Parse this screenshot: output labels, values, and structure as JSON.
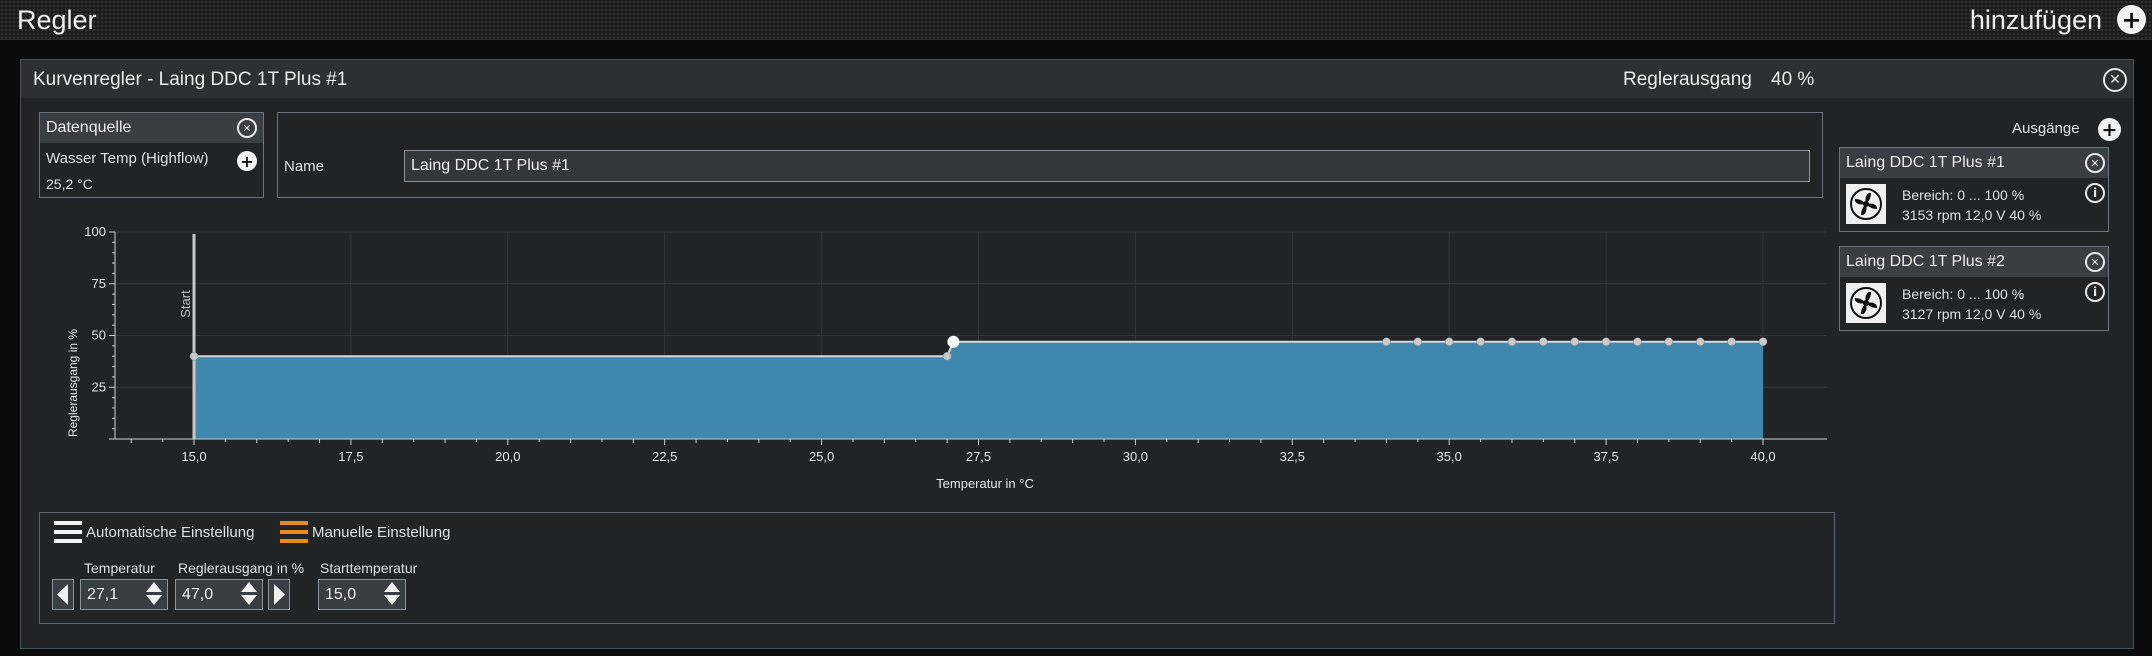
{
  "topbar": {
    "title": "Regler",
    "add_label": "hinzufügen"
  },
  "panel": {
    "title": "Kurvenregler  -  Laing DDC 1T Plus #1",
    "output_label": "Reglerausgang",
    "output_value": "40 %"
  },
  "datasource": {
    "header": "Datenquelle",
    "sensor": "Wasser Temp (Highflow)",
    "value": "25,2 °C"
  },
  "name_field": {
    "label": "Name",
    "value": "Laing DDC 1T Plus #1"
  },
  "chart_data": {
    "type": "area",
    "xlabel": "Temperatur in °C",
    "ylabel": "Reglerausgang in %",
    "start_label": "Start",
    "xlim": [
      13.0,
      40.0
    ],
    "ylim": [
      0,
      100
    ],
    "x_ticks": [
      "15,0",
      "17,5",
      "20,0",
      "22,5",
      "25,0",
      "27,5",
      "30,0",
      "32,5",
      "35,0",
      "37,5",
      "40,0"
    ],
    "y_ticks": [
      "25",
      "50",
      "75",
      "100"
    ],
    "start_temperature": 15.0,
    "points": [
      {
        "x": 15.0,
        "y": 40.0
      },
      {
        "x": 27.0,
        "y": 40.0
      },
      {
        "x": 27.1,
        "y": 47.0
      },
      {
        "x": 34.0,
        "y": 47.0
      },
      {
        "x": 34.5,
        "y": 47.0
      },
      {
        "x": 35.0,
        "y": 47.0
      },
      {
        "x": 35.5,
        "y": 47.0
      },
      {
        "x": 36.0,
        "y": 47.0
      },
      {
        "x": 36.5,
        "y": 47.0
      },
      {
        "x": 37.0,
        "y": 47.0
      },
      {
        "x": 37.5,
        "y": 47.0
      },
      {
        "x": 38.0,
        "y": 47.0
      },
      {
        "x": 38.5,
        "y": 47.0
      },
      {
        "x": 39.0,
        "y": 47.0
      },
      {
        "x": 39.5,
        "y": 47.0
      },
      {
        "x": 40.0,
        "y": 47.0
      }
    ],
    "selected_point_index": 2,
    "fill_color": "#3e87ad",
    "grid": true
  },
  "controls": {
    "auto_label": "Automatische Einstellung",
    "manual_label": "Manuelle Einstellung",
    "auto_color": "#f2f2f2",
    "manual_color": "#e98a1f",
    "temp_label": "Temperatur",
    "temp_value": "27,1",
    "out_label": "Reglerausgang in %",
    "out_value": "47,0",
    "start_label": "Starttemperatur",
    "start_value": "15,0"
  },
  "outputs": {
    "header": "Ausgänge",
    "items": [
      {
        "name": "Laing DDC 1T Plus #1",
        "range": "Bereich:  0 ... 100  %",
        "stats": "3153 rpm  12,0 V  40 %"
      },
      {
        "name": "Laing DDC 1T Plus #2",
        "range": "Bereich:  0 ... 100  %",
        "stats": "3127 rpm  12,0 V  40 %"
      }
    ]
  }
}
